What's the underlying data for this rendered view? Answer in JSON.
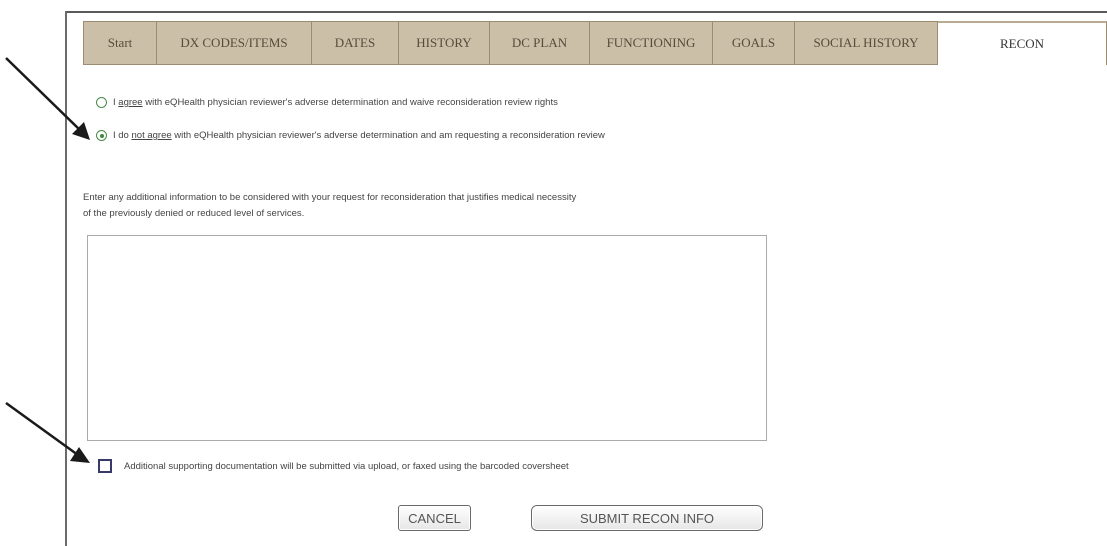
{
  "tabs": [
    {
      "label": "Start",
      "active": false
    },
    {
      "label": "DX CODES/ITEMS",
      "active": false
    },
    {
      "label": "DATES",
      "active": false
    },
    {
      "label": "HISTORY",
      "active": false
    },
    {
      "label": "DC PLAN",
      "active": false
    },
    {
      "label": "FUNCTIONING",
      "active": false
    },
    {
      "label": "GOALS",
      "active": false
    },
    {
      "label": "SOCIAL HISTORY",
      "active": false
    },
    {
      "label": "RECON",
      "active": true
    }
  ],
  "determination": {
    "agree": {
      "pre": "I ",
      "emph": "agree",
      "post": " with eQHealth physician reviewer's adverse determination and waive  reconsideration review rights",
      "checked": false
    },
    "disagree": {
      "pre": "I do ",
      "emph": "not agree",
      "post": " with eQHealth physician reviewer's adverse determination and am requesting a reconsideration review",
      "checked": true
    }
  },
  "prompt": {
    "line1": "Enter any additional information to be considered with your request for reconsideration that justifies medical necessity",
    "line2": "of the previously denied or reduced level of services."
  },
  "reason_text": "",
  "supporting_docs": {
    "label": "Additional supporting documentation will be submitted via upload, or faxed using the barcoded coversheet",
    "checked": false
  },
  "buttons": {
    "cancel": "CANCEL",
    "submit": "SUBMIT RECON INFO"
  }
}
